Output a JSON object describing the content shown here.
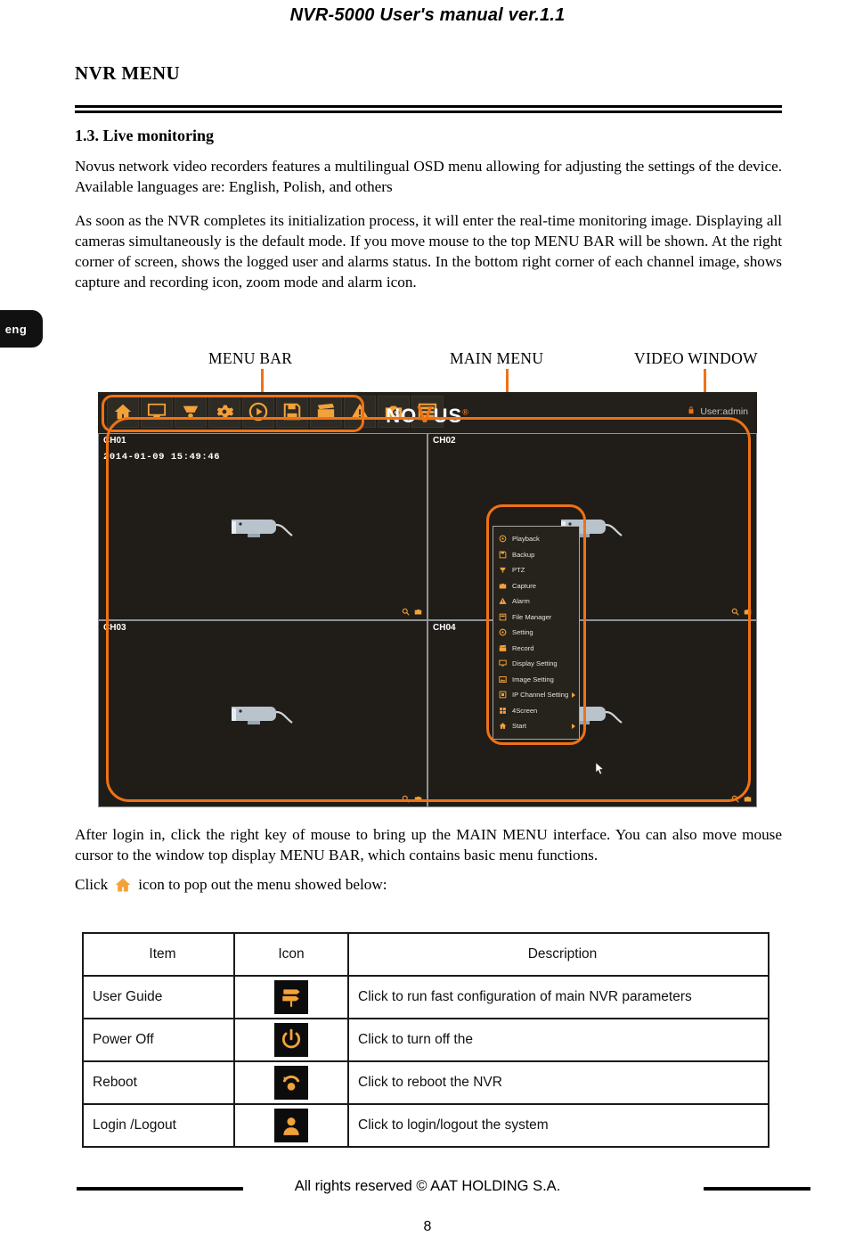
{
  "document": {
    "header": "NVR-5000 User's manual ver.1.1",
    "page_title": "NVR MENU",
    "section_heading": "1.3. Live monitoring",
    "paragraph_1": "Novus network video recorders features a multilingual OSD menu allowing for adjusting the settings of the device. Available languages are: English, Polish, and others",
    "paragraph_2": "As soon as the NVR completes its initialization process, it will enter the real-time monitoring image. Displaying all cameras simultaneously is the default mode. If you move mouse to the top MENU BAR will be shown. At the right corner of screen, shows the logged user and alarms status. In the bottom right corner of each channel image, shows capture and recording icon, zoom mode and alarm icon.",
    "paragraph_3": "After login in, click the right key of mouse to bring up the MAIN MENU interface. You can also move mouse cursor to the window top display MENU BAR, which contains basic menu functions.",
    "paragraph_4_before": "Click",
    "paragraph_4_after": "icon to pop out the menu showed below:",
    "language_tab": "eng",
    "footer": "All rights reserved © AAT HOLDING S.A.",
    "page_number": "8"
  },
  "callouts": {
    "menu_bar": "MENU BAR",
    "main_menu": "MAIN MENU",
    "video_window": "VIDEO WINDOW"
  },
  "nvr": {
    "logo_pre": "NO",
    "logo_v": "V",
    "logo_post": "US",
    "logo_tm": "®",
    "user_status": "User:admin",
    "toolbar_icons": [
      "home-icon",
      "monitor-icon",
      "dome-camera-icon",
      "gear-icon",
      "playback-icon",
      "save-icon",
      "clapperboard-icon",
      "warning-icon",
      "camera-icon",
      "grid-icon"
    ],
    "channels": [
      {
        "label": "CH01",
        "time": "2014-01-09 15:49:46"
      },
      {
        "label": "CH02",
        "time": ""
      },
      {
        "label": "CH03",
        "time": ""
      },
      {
        "label": "CH04",
        "time": ""
      }
    ],
    "main_menu_items": [
      {
        "label": "Playback",
        "icon": "playback-icon",
        "submenu": false
      },
      {
        "label": "Backup",
        "icon": "backup-icon",
        "submenu": false
      },
      {
        "label": "PTZ",
        "icon": "ptz-icon",
        "submenu": false
      },
      {
        "label": "Capture",
        "icon": "capture-icon",
        "submenu": false
      },
      {
        "label": "Alarm",
        "icon": "alarm-icon",
        "submenu": false
      },
      {
        "label": "File Manager",
        "icon": "file-icon",
        "submenu": false
      },
      {
        "label": "Setting",
        "icon": "gear-icon",
        "submenu": false
      },
      {
        "label": "Record",
        "icon": "record-icon",
        "submenu": false
      },
      {
        "label": "Display Setting",
        "icon": "monitor-icon",
        "submenu": false
      },
      {
        "label": "Image Setting",
        "icon": "image-icon",
        "submenu": false
      },
      {
        "label": "IP Channel Setting",
        "icon": "ip-channel-icon",
        "submenu": true
      },
      {
        "label": "4Screen",
        "icon": "grid-icon",
        "submenu": false
      },
      {
        "label": "Start",
        "icon": "home-icon",
        "submenu": true
      }
    ]
  },
  "table": {
    "headers": {
      "item": "Item",
      "icon": "Icon",
      "description": "Description"
    },
    "rows": [
      {
        "item": "User Guide",
        "icon": "signpost-icon",
        "description": "Click to run fast configuration of main NVR parameters"
      },
      {
        "item": "Power Off",
        "icon": "power-icon",
        "description": "Click to turn off the"
      },
      {
        "item": "Reboot",
        "icon": "reboot-icon",
        "description": "Click to reboot the NVR"
      },
      {
        "item": "Login /Logout",
        "icon": "user-icon",
        "description": "Click to login/logout the system"
      }
    ]
  },
  "colors": {
    "accent_orange": "#ef7215",
    "icon_orange": "#f2a23a",
    "nvr_background": "#1d1a15"
  }
}
